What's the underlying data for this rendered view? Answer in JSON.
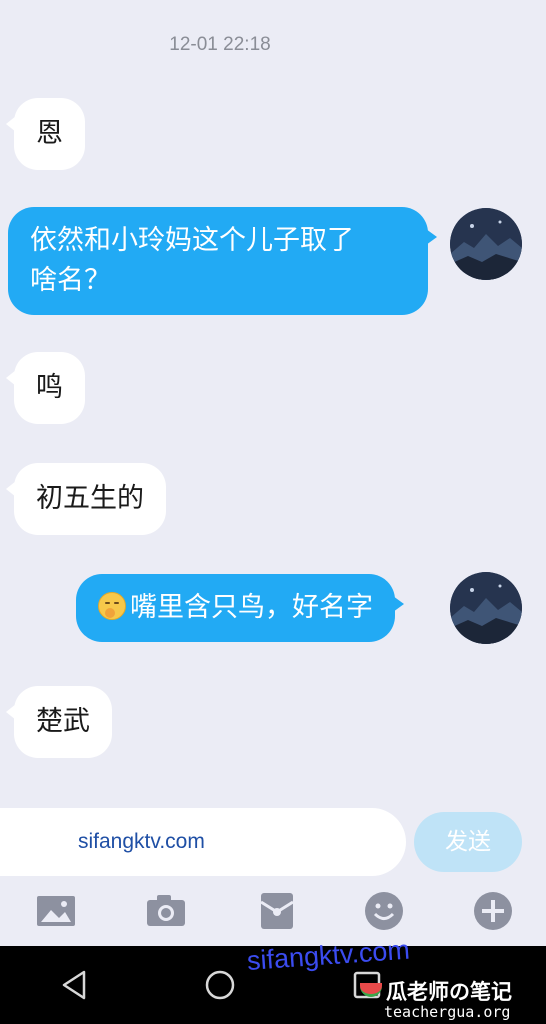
{
  "timestamp": "12-01 22:18",
  "messages": [
    {
      "side": "in",
      "text": "恩"
    },
    {
      "side": "out",
      "text_line1": "依然和小玲妈这个儿子取了",
      "text_line2": "啥名？"
    },
    {
      "side": "in",
      "text": "鸣"
    },
    {
      "side": "in",
      "text": "初五生的"
    },
    {
      "side": "out",
      "emoji": "yawning-face-emoji",
      "text": "嘴里含只鸟，好名字"
    },
    {
      "side": "in",
      "text": "楚武"
    }
  ],
  "input": {
    "value": "sifangktv.com",
    "send_label": "发送"
  },
  "toolbar": {
    "icons": [
      "image-icon",
      "camera-icon",
      "red-envelope-icon",
      "emoji-icon",
      "plus-icon"
    ]
  },
  "navbar": {
    "icons": [
      "back-icon",
      "home-icon",
      "recents-icon"
    ]
  },
  "watermarks": {
    "site": "sifangktv.com",
    "brand": "瓜老师の笔记",
    "brand_url": "teachergua.org"
  },
  "colors": {
    "background": "#ebecf5",
    "outgoing_bubble": "#22aaf4",
    "incoming_bubble": "#ffffff",
    "send_button": "#bfe3f7"
  }
}
